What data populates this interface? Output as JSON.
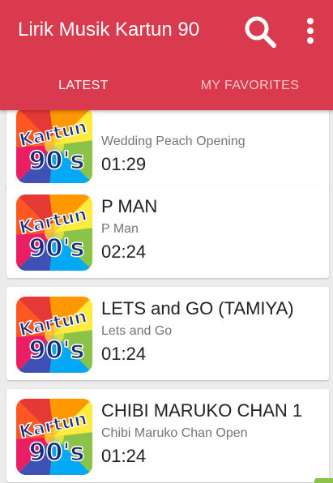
{
  "app": {
    "title": "Lirik Musik Kartun 90"
  },
  "toolbar": {
    "search_icon": "search-icon",
    "more_icon": "more-vert-icon"
  },
  "tabs": [
    {
      "label": "LATEST",
      "active": true
    },
    {
      "label": "MY FAVORITES",
      "active": false
    }
  ],
  "thumbnail": {
    "line1": "Kartun",
    "line2": "90's"
  },
  "items": [
    {
      "title": "",
      "subtitle": "Wedding Peach Opening",
      "duration": "01:29"
    },
    {
      "title": "P MAN",
      "subtitle": "P Man",
      "duration": "02:24"
    },
    {
      "title": "LETS and GO (TAMIYA)",
      "subtitle": "Lets and Go",
      "duration": "01:24"
    },
    {
      "title": "CHIBI MARUKO CHAN 1",
      "subtitle": "Chibi Maruko Chan Open",
      "duration": "01:24"
    }
  ],
  "colors": {
    "primary": "#d93a4d",
    "background": "#ececec",
    "card": "#ffffff"
  }
}
